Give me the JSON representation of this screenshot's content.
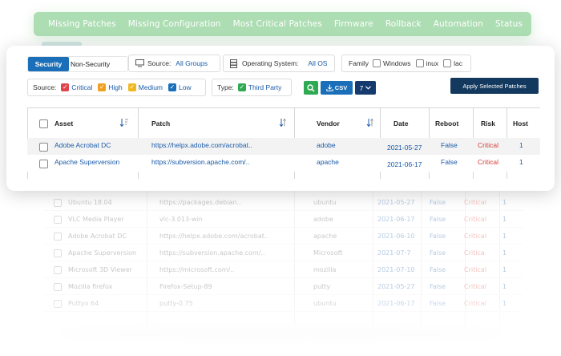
{
  "nav": {
    "items": [
      "Missing Patches",
      "Missing Configuration",
      "Most Critical Patches",
      "Firmware",
      "Rollback",
      "Automation",
      "Status"
    ]
  },
  "filters": {
    "tabs": {
      "security": "Security",
      "non_security": "Non-Security"
    },
    "source": {
      "label": "Source:",
      "value": "All Groups"
    },
    "os": {
      "label": "Operating System:",
      "value": "All OS"
    },
    "family": {
      "label": "Family",
      "options": [
        "Windows",
        "inux",
        "lac"
      ]
    },
    "severity": {
      "label": "Source:",
      "options": [
        {
          "label": "Critical",
          "color": "#e0434b",
          "checked": true
        },
        {
          "label": "High",
          "color": "#f0a020",
          "checked": true
        },
        {
          "label": "Medium",
          "color": "#f0b820",
          "checked": true
        },
        {
          "label": "Low",
          "color": "#1b6fb8",
          "checked": true
        }
      ]
    },
    "type": {
      "label": "Type:",
      "option": "Third Party",
      "color": "#2faa52"
    }
  },
  "actions": {
    "csv": "CSV",
    "count": "7",
    "apply": "Apply Selected Patches"
  },
  "table": {
    "headers": {
      "asset": "Asset",
      "patch": "Patch",
      "vendor": "Vendor",
      "date": "Date",
      "reboot": "Reboot",
      "risk": "Risk",
      "host": "Host"
    },
    "rows": [
      {
        "asset": "Adobe Acrobat DC",
        "patch": "https://helpx.adobe.com/acrobat..",
        "vendor": "adobe",
        "date": "2021-05-27",
        "reboot": "False",
        "risk": "Critical",
        "host": "1"
      },
      {
        "asset": "Apache Superversion",
        "patch": "https://subversion.apache.com/..",
        "vendor": "apache",
        "date": "2021-06-17",
        "reboot": "False",
        "risk": "Critical",
        "host": "1"
      }
    ]
  },
  "background_rows": [
    {
      "asset": "Ubuntu 18.04",
      "patch": "https://packages.debian..",
      "vendor": "ubuntu",
      "date": "2021-05-27",
      "reboot": "False",
      "risk": "Critical",
      "host": "1"
    },
    {
      "asset": "VLC Media Player",
      "patch": "vlc-3.013-win",
      "vendor": "adobe",
      "date": "2021-06-17",
      "reboot": "False",
      "risk": "Critical",
      "host": "1"
    },
    {
      "asset": "Adobe Acrobat DC",
      "patch": "https://helpx.adobe.com/acrobat..",
      "vendor": "apache",
      "date": "2021-06-10",
      "reboot": "False",
      "risk": "Critical",
      "host": "1"
    },
    {
      "asset": "Apache Superversion",
      "patch": "https://subversion.apache.com/..",
      "vendor": "Microsoft",
      "date": "2021-07-7",
      "reboot": "False",
      "risk": "Critica",
      "host": "1"
    },
    {
      "asset": "Microsoft 3D Viewer",
      "patch": "https://microsoft.com/..",
      "vendor": "mozilla",
      "date": "2021-07-10",
      "reboot": "False",
      "risk": "Critical",
      "host": "1"
    },
    {
      "asset": "Mozilla firefox",
      "patch": "Firefox-Setup-89",
      "vendor": "putty",
      "date": "2021-05-27",
      "reboot": "False",
      "risk": "Critical",
      "host": "1"
    },
    {
      "asset": "Puttyx 64",
      "patch": "putty-0.75",
      "vendor": "ubuntu",
      "date": "2021-06-17",
      "reboot": "False",
      "risk": "Critical",
      "host": "1"
    }
  ],
  "colors": {
    "primary": "#1b6fb8",
    "dark": "#13395f",
    "green": "#2faa52",
    "risk": "#d43f3a",
    "nav_bg": "#9fd8a6"
  }
}
